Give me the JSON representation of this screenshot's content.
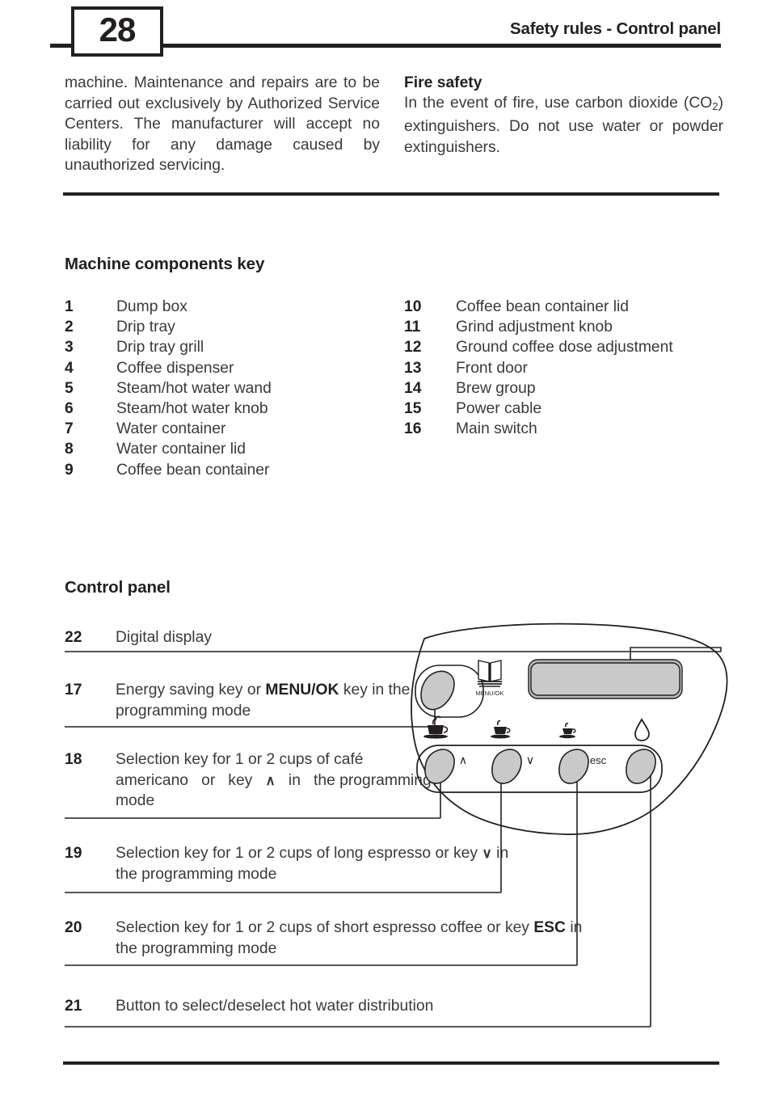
{
  "header": {
    "page_number": "28",
    "title": "Safety rules - Control panel"
  },
  "intro": {
    "left_paragraph": "machine. Maintenance and repairs are to be carried out exclusively by Authorized Service Centers. The manufacturer will accept no liability for any damage caused by unauthorized servicing.",
    "right_heading": "Fire safety",
    "right_paragraph_part1": "In the event of fire, use carbon dioxide (CO",
    "right_paragraph_sub": "2",
    "right_paragraph_part2": ") extinguishers. Do not use water or powder extinguishers."
  },
  "components": {
    "heading": "Machine components key",
    "left_items": [
      {
        "num": "1",
        "label": "Dump box"
      },
      {
        "num": "2",
        "label": "Drip tray"
      },
      {
        "num": "3",
        "label": "Drip tray grill"
      },
      {
        "num": "4",
        "label": "Coffee dispenser"
      },
      {
        "num": "5",
        "label": "Steam/hot water wand"
      },
      {
        "num": "6",
        "label": "Steam/hot water knob"
      },
      {
        "num": "7",
        "label": "Water container"
      },
      {
        "num": "8",
        "label": "Water container lid"
      },
      {
        "num": "9",
        "label": "Coffee bean container"
      }
    ],
    "right_items": [
      {
        "num": "10",
        "label": "Coffee bean container lid"
      },
      {
        "num": "11",
        "label": "Grind adjustment knob"
      },
      {
        "num": "12",
        "label": "Ground coffee dose adjustment"
      },
      {
        "num": "13",
        "label": "Front door"
      },
      {
        "num": "14",
        "label": "Brew group"
      },
      {
        "num": "15",
        "label": "Power cable"
      },
      {
        "num": "16",
        "label": "Main switch"
      }
    ]
  },
  "control_panel": {
    "heading": "Control panel",
    "entries": [
      {
        "num": "22",
        "line1": "Digital display",
        "line2": "",
        "line3": ""
      },
      {
        "num": "17",
        "line1_a": "Energy saving key or ",
        "line1_b": "MENU/OK",
        "line2": "key in the programming mode"
      },
      {
        "num": "18",
        "line1": "Selection key for 1 or 2 cups of café",
        "line2_a": "americano   or   key   ",
        "line2_b": "∧",
        "line2_c": "   in   the",
        "line3": "programming mode"
      },
      {
        "num": "19",
        "line1": "Selection key for 1 or 2 cups of long espresso",
        "line2_a": "or key ",
        "line2_b": "∨",
        "line2_c": " in the programming mode"
      },
      {
        "num": "20",
        "line1": "Selection key for 1 or 2 cups of short espresso coffee or",
        "line2_a": "key ",
        "line2_b": "ESC",
        "line2_c": " in the programming mode"
      },
      {
        "num": "21",
        "line1": "Button to select/deselect hot water distribution"
      }
    ],
    "diagram": {
      "menu_ok_label": "MENU/OK",
      "button_labels": [
        "∧",
        "∨",
        "esc",
        ""
      ],
      "icon_names": [
        "book-icon",
        "large-cup-icon",
        "medium-cup-icon",
        "small-cup-icon",
        "water-drop-icon"
      ],
      "display_fill": "#c9c9c9",
      "button_fill": "#c9c9c9",
      "outline_color": "#231f20"
    }
  }
}
